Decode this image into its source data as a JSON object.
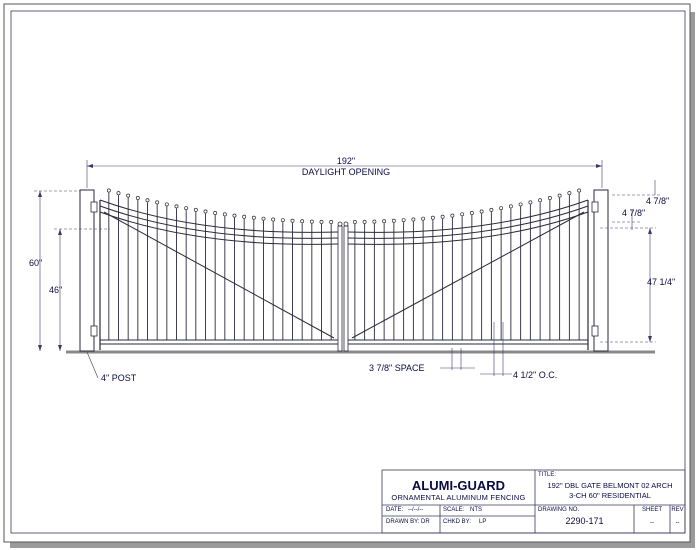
{
  "dimensions": {
    "overall": "192\"",
    "overall_label": "DAYLIGHT OPENING",
    "height_post": "60\"",
    "height_picket": "46\"",
    "post_label": "4\" POST",
    "space": "3 7/8\" SPACE",
    "oc": "4 1/2\" O.C.",
    "arch_top": "4 7/8\"",
    "arch_inner": "4 7/8\"",
    "right_height": "47 1/4\""
  },
  "title_block": {
    "company": "ALUMI-GUARD",
    "company_sub": "ORNAMENTAL ALUMINUM FENCING",
    "title_label": "TITLE:",
    "title_line1": "192\" DBL GATE BELMONT 02 ARCH",
    "title_line2": "3-CH 60\" RESIDENTIAL",
    "date_label": "DATE:",
    "date_value": "--/--/--",
    "scale_label": "SCALE:",
    "scale_value": "NTS",
    "drawn_label": "DRAWN BY:",
    "drawn_value": "DR",
    "chkd_label": "CHKD BY:",
    "chkd_value": "LP",
    "drawing_no_label": "DRAWING NO.",
    "drawing_no_value": "2290-171",
    "sheet_label": "SHEET",
    "sheet_value": "--",
    "rev_label": "REV",
    "rev_value": "--"
  }
}
